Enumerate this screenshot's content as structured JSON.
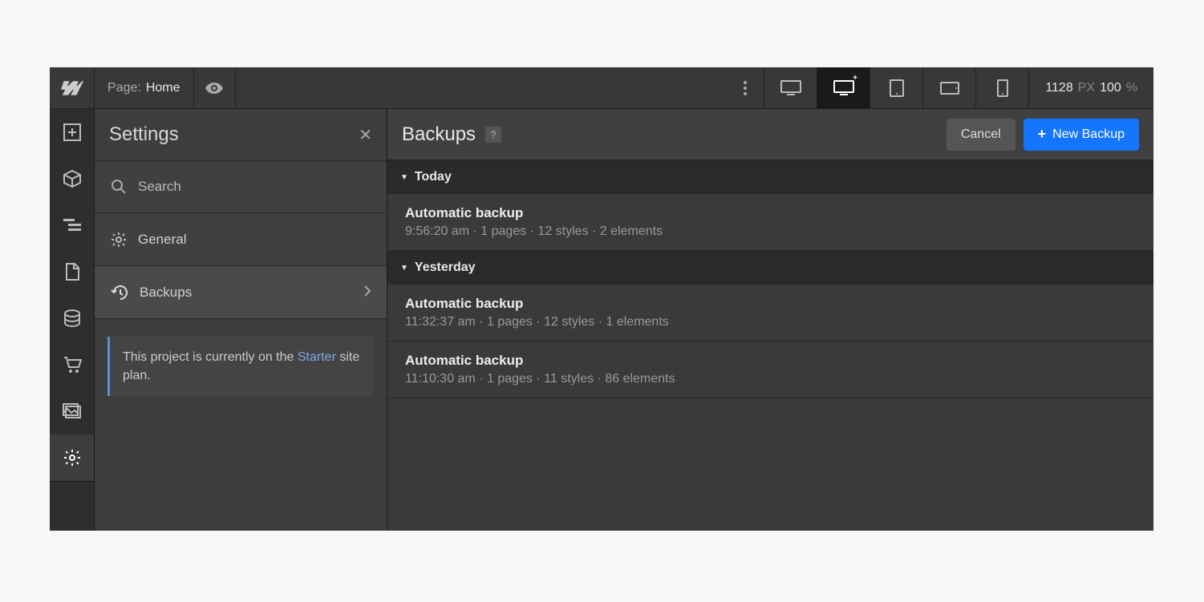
{
  "topbar": {
    "page_label": "Page:",
    "page_name": "Home",
    "width_value": "1128",
    "width_unit": "PX",
    "zoom_value": "100",
    "zoom_unit": "%"
  },
  "settings": {
    "title": "Settings",
    "search_placeholder": "Search",
    "items": {
      "general": "General",
      "backups": "Backups"
    },
    "notice_pre": "This project is currently on the ",
    "notice_link": "Starter",
    "notice_post": " site plan."
  },
  "main": {
    "title": "Backups",
    "help": "?",
    "cancel": "Cancel",
    "new_backup": "New Backup"
  },
  "groups": [
    {
      "label": "Today",
      "rows": [
        {
          "title": "Automatic backup",
          "meta": "9:56:20 am · 1 pages · 12 styles · 2 elements"
        }
      ]
    },
    {
      "label": "Yesterday",
      "rows": [
        {
          "title": "Automatic backup",
          "meta": "11:32:37 am · 1 pages · 12 styles · 1 elements"
        },
        {
          "title": "Automatic backup",
          "meta": "11:10:30 am · 1 pages · 11 styles · 86 elements"
        }
      ]
    }
  ]
}
